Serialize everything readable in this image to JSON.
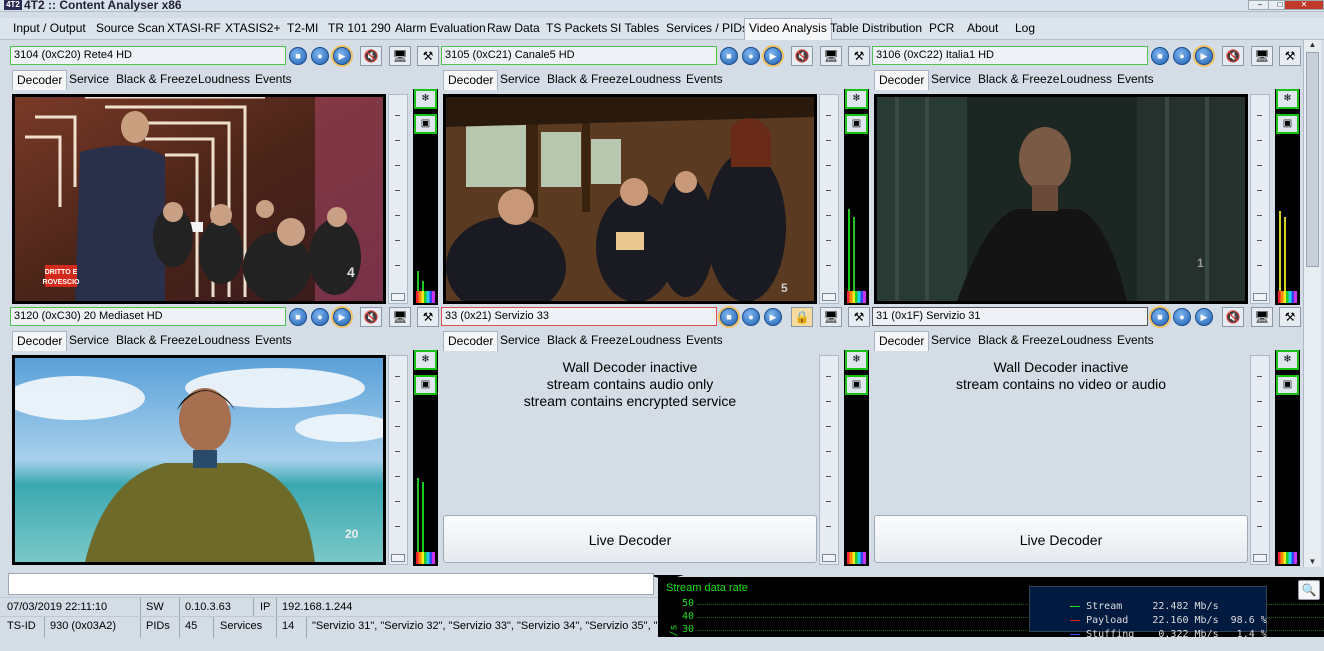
{
  "window": {
    "title": "4T2 :: Content Analyser x86",
    "logo": "4T2"
  },
  "menu": [
    "Input / Output",
    "Source Scan",
    "XTASI-RF",
    "XTASIS2+",
    "T2-MI",
    "TR 101 290",
    "Alarm Evaluation",
    "Raw Data",
    "TS Packets",
    "SI Tables",
    "Services / PIDs",
    "Video Analysis",
    "Table Distribution",
    "PCR",
    "About",
    "Log"
  ],
  "active_menu": "Video Analysis",
  "tabs": [
    "Decoder",
    "Service",
    "Black & Freeze",
    "Loudness",
    "Events"
  ],
  "panels": [
    {
      "channel": "3104 (0xC20) Rete4 HD",
      "status": "video"
    },
    {
      "channel": "3105 (0xC21) Canale5 HD",
      "status": "video"
    },
    {
      "channel": "3106 (0xC22) Italia1 HD",
      "status": "video"
    },
    {
      "channel": "3120 (0xC30) 20 Mediaset HD",
      "status": "video"
    },
    {
      "channel": "33 (0x21) Servizio 33",
      "status": "inactive",
      "messages": [
        "Wall Decoder inactive",
        "stream contains audio only",
        "stream contains encrypted service"
      ],
      "button": "Live Decoder"
    },
    {
      "channel": "31 (0x1F) Servizio 31",
      "status": "inactive",
      "messages": [
        "Wall Decoder inactive",
        "stream contains no video or audio"
      ],
      "button": "Live Decoder"
    }
  ],
  "video_overlays": {
    "rete4_logo": "DRITTO E ROVESCIO"
  },
  "status": {
    "datetime": "07/03/2019 22:11:10",
    "sw_label": "SW",
    "sw_value": "0.10.3.63",
    "ip_label": "IP",
    "ip_value": "192.168.1.244",
    "tsid_label": "TS-ID",
    "tsid_value": "930 (0x03A2)",
    "pids_label": "PIDs",
    "pids_value": "45",
    "services_label": "Services",
    "services_value": "14",
    "services_list": "\"Servizio 31\", \"Servizio 32\", \"Servizio 33\", \"Servizio 34\", \"Servizio 35\", \"S"
  },
  "graph": {
    "title": "Stream data rate",
    "ylabel_fragment": "/s",
    "yticks": [
      "50",
      "40",
      "30"
    ],
    "legend": [
      {
        "name": "Stream",
        "value": "22.482 Mb/s",
        "pct": "",
        "color": "#22dd22"
      },
      {
        "name": "Payload",
        "value": "22.160 Mb/s",
        "pct": "98.6 %",
        "color": "#dd2222"
      },
      {
        "name": "Stuffing",
        "value": "0.322 Mb/s",
        "pct": "1.4 %",
        "color": "#3355ff"
      }
    ]
  },
  "colors": {
    "ok_border": "#4fc24f",
    "alert_border": "#e05050",
    "meter_green": "#1ec81e"
  }
}
